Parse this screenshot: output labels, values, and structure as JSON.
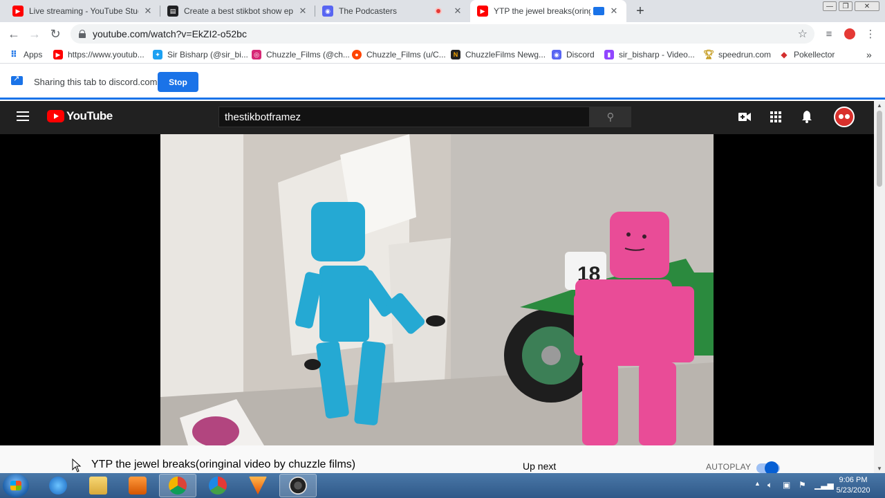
{
  "browser": {
    "tabs": [
      {
        "title": "Live streaming - YouTube Studio",
        "icon": "youtube-icon",
        "color": "#ff0000"
      },
      {
        "title": "Create a best stikbot show episo",
        "icon": "doc-icon",
        "color": "#202124"
      },
      {
        "title": "The Podcasters",
        "icon": "discord-icon",
        "color": "#5865f2"
      },
      {
        "title": "YTP the jewel breaks(oringin",
        "icon": "youtube-icon",
        "color": "#ff0000",
        "active": true
      }
    ],
    "new_tab": "+",
    "address": "youtube.com/watch?v=EkZI2-o52bc",
    "bookmarks": [
      {
        "label": "Apps",
        "icon": "apps-grid-icon"
      },
      {
        "label": "https://www.youtub...",
        "icon": "youtube-icon"
      },
      {
        "label": "Sir Bisharp (@sir_bi...",
        "icon": "twitter-icon"
      },
      {
        "label": "Chuzzle_Films (@ch...",
        "icon": "instagram-icon"
      },
      {
        "label": "Chuzzle_Films (u/C...",
        "icon": "reddit-icon"
      },
      {
        "label": "ChuzzleFilms Newg...",
        "icon": "newgrounds-icon"
      },
      {
        "label": "Discord",
        "icon": "discord-icon"
      },
      {
        "label": "sir_bisharp - Video...",
        "icon": "twitch-icon"
      },
      {
        "label": "speedrun.com",
        "icon": "trophy-icon"
      },
      {
        "label": "Pokellector",
        "icon": "pokellector-icon"
      }
    ],
    "bookmarks_more": "»"
  },
  "sharing": {
    "text": "Sharing this tab to discord.com",
    "stop_label": "Stop"
  },
  "youtube": {
    "logo_text": "YouTube",
    "search_value": "thestikbotframez",
    "video_title": "YTP the jewel breaks(oringinal video by chuzzle films)",
    "up_next": "Up next",
    "autoplay": "AUTOPLAY",
    "autoplay_on": true,
    "video_scene_number": "18"
  },
  "taskbar": {
    "time": "9:06 PM",
    "date": "5/23/2020"
  }
}
